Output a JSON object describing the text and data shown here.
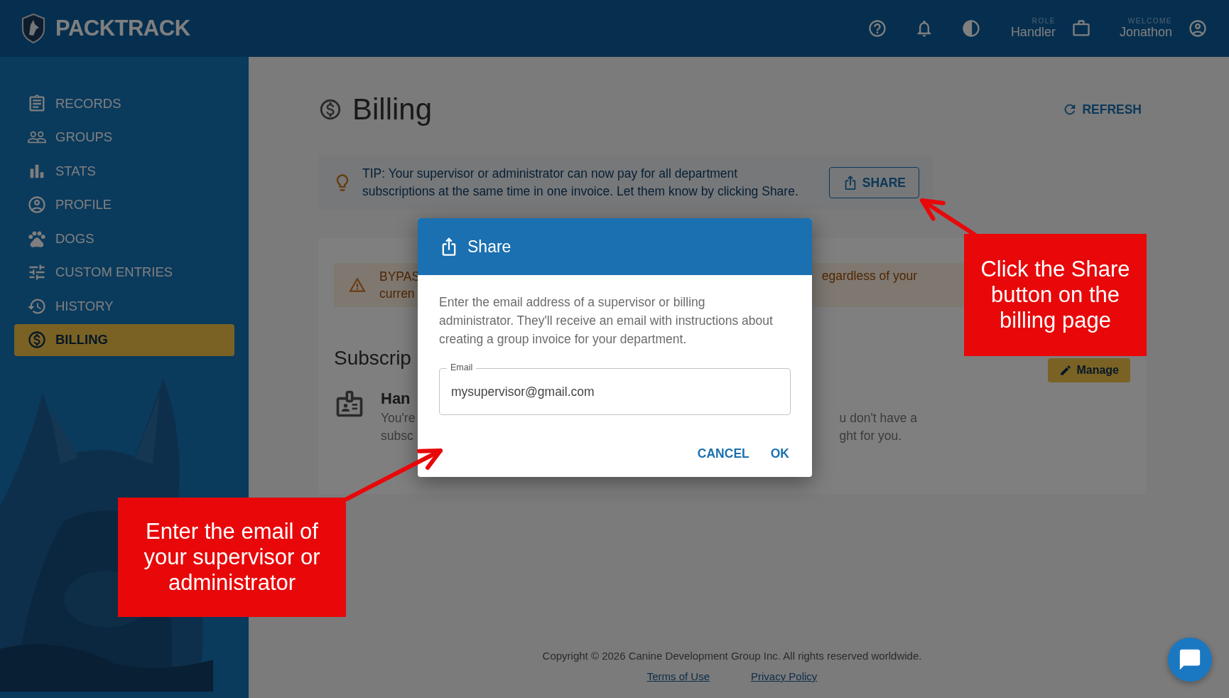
{
  "header": {
    "brand": "PACKTRACK",
    "role_label": "ROLE",
    "role": "Handler",
    "welcome_label": "WELCOME",
    "user": "Jonathon"
  },
  "sidebar": {
    "items": [
      {
        "label": "RECORDS",
        "kind": "records",
        "selected": false
      },
      {
        "label": "GROUPS",
        "kind": "groups",
        "selected": false
      },
      {
        "label": "STATS",
        "kind": "stats",
        "selected": false
      },
      {
        "label": "PROFILE",
        "kind": "profile",
        "selected": false
      },
      {
        "label": "DOGS",
        "kind": "dogs",
        "selected": false
      },
      {
        "label": "CUSTOM ENTRIES",
        "kind": "custom",
        "selected": false
      },
      {
        "label": "HISTORY",
        "kind": "history",
        "selected": false
      },
      {
        "label": "BILLING",
        "kind": "billing",
        "selected": true
      }
    ]
  },
  "page": {
    "title": "Billing",
    "refresh": "REFRESH",
    "tip": {
      "text": "TIP: Your supervisor or administrator can now pay for all department subscriptions at the same time in one invoice. Let them know by clicking Share.",
      "button": "SHARE"
    },
    "warning": {
      "left": [
        "BYPAS",
        "curren"
      ],
      "right": [
        "egardless of your"
      ]
    },
    "subscription": {
      "heading": "Subscrip",
      "manage": "Manage",
      "plan_title": "Han",
      "left": [
        "You're",
        "subsc"
      ],
      "right": [
        "u don't have a",
        "ght for you."
      ]
    }
  },
  "footer": {
    "copyright": "Copyright © 2026 Canine Development Group Inc. All rights reserved worldwide.",
    "links": [
      "Terms of Use",
      "Privacy Policy"
    ]
  },
  "dialog": {
    "title": "Share",
    "text": "Enter the email address of a supervisor or billing administrator. They'll receive an email with instructions about creating a group invoice for your department.",
    "email_label": "Email",
    "email_value": "mysupervisor@gmail.com",
    "buttons": [
      "CANCEL",
      "OK"
    ]
  },
  "callouts": [
    {
      "text": "Click the Share button on the billing page"
    },
    {
      "text": "Enter the email of your supervisor or administrator"
    }
  ]
}
